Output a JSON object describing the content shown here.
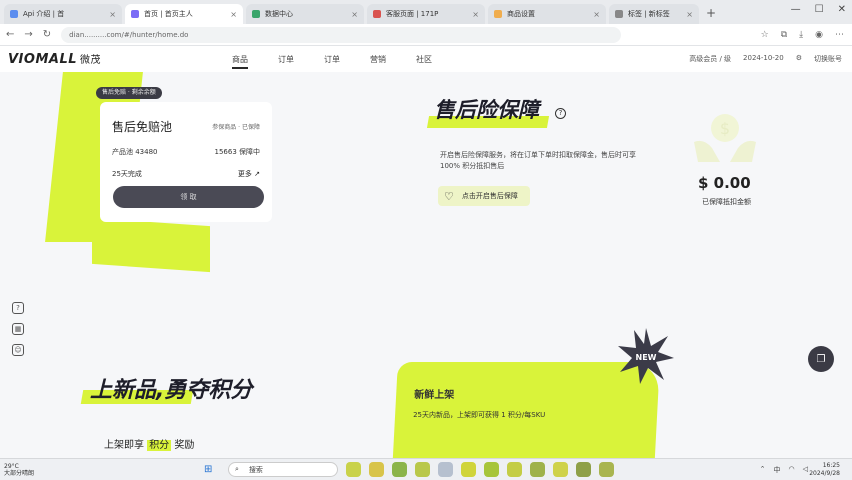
{
  "browser": {
    "tabs": [
      {
        "label": "Api 介绍 | 首",
        "color": "#5b8def"
      },
      {
        "label": "首页 | 首页主人",
        "color": "#7b6cf6"
      },
      {
        "label": "数据中心",
        "color": "#3aa56b"
      },
      {
        "label": "客服页面 | 171P",
        "color": "#d9534f"
      },
      {
        "label": "商品设置",
        "color": "#f0ad4e"
      },
      {
        "label": "标签 | 新标签",
        "color": "#888888"
      }
    ],
    "url": "dian..........com/#/hunter/home.do"
  },
  "site": {
    "logo_text": "VIOMALL",
    "logo_cn": "微茂",
    "menu": [
      "商品",
      "订单",
      "订单",
      "营销",
      "社区"
    ],
    "right_menu": [
      "高级会员 / 级",
      "2024-10-20",
      "切换账号"
    ]
  },
  "pool_card": {
    "badge": "售后免赔 · 剩余余额",
    "title": "售后免赔池",
    "title_sub": "参保商品 · 已保障",
    "products_label": "产品池 43480",
    "status_label": "15663 保障中",
    "row3_label": "25天完成",
    "more_label": "更多 ↗",
    "claim_button": "领 取"
  },
  "insurance": {
    "title": "售后险保障",
    "help": "?",
    "description": "开启售后险保障服务，将在订单下单时扣取保障金，售后时可享 100% 积分抵扣售后",
    "enable_button": "点击开启售后保障",
    "amount": "$ 0.00",
    "amount_label": "已保障抵扣金额"
  },
  "section": {
    "title": "上新品,勇夺积分",
    "sub_prefix": "上架即享",
    "sub_highlight": "积分",
    "sub_suffix": "奖励"
  },
  "new_card": {
    "badge": "NEW",
    "title": "新鲜上架",
    "desc": "25天内新品，上架即可获得 1 积分/每SKU"
  },
  "taskbar": {
    "weather_line1": "29°C",
    "weather_line2": "大部分晴朗",
    "search": "搜索",
    "tray": "中",
    "time": "16:25",
    "date": "2024/9/28"
  }
}
